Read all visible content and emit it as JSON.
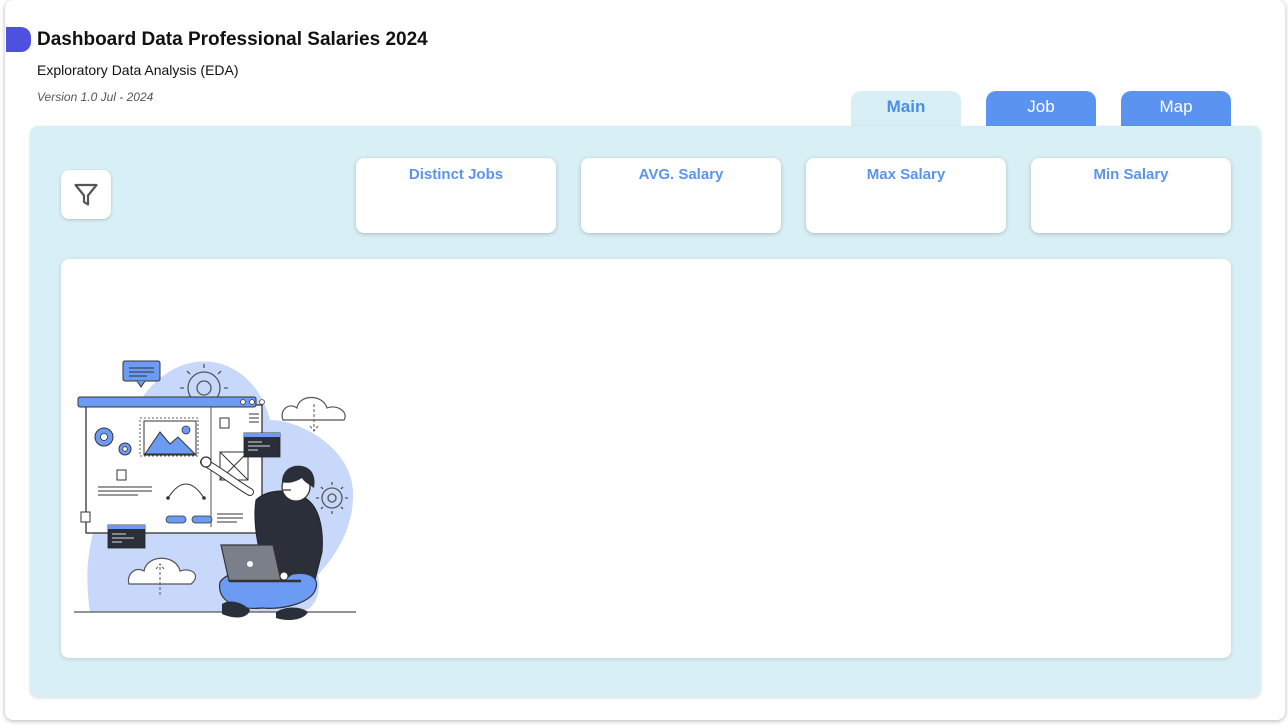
{
  "header": {
    "title": "Dashboard Data Professional Salaries 2024",
    "subtitle": "Exploratory Data Analysis (EDA)",
    "version": "Version 1.0 Jul - 2024"
  },
  "tabs": [
    {
      "label": "Main",
      "active": true
    },
    {
      "label": "Job",
      "active": false
    },
    {
      "label": "Map",
      "active": false
    }
  ],
  "kpi_cards": [
    {
      "label": "Distinct Jobs"
    },
    {
      "label": "AVG. Salary"
    },
    {
      "label": "Max Salary"
    },
    {
      "label": "Min Salary"
    }
  ],
  "filter": {
    "icon": "filter-icon"
  },
  "illustration": {
    "icon": "person-with-laptop-illustration"
  },
  "colors": {
    "accent": "#4f4fe0",
    "tab_blue": "#5b94f0",
    "active_tab_text": "#4a8ee8",
    "panel_background": "#d8f0f5",
    "illustration_blue": "#6b9bf2",
    "illustration_blob": "#c8d8fa"
  }
}
